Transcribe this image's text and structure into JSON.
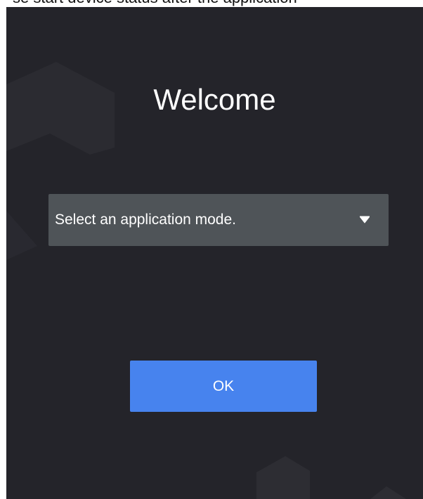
{
  "top_fragment": {
    "text": "se start device status after the application"
  },
  "welcome": {
    "title": "Welcome"
  },
  "mode_select": {
    "placeholder": "Select an application mode.",
    "icon": "chevron-down-icon"
  },
  "ok_button": {
    "label": "OK"
  },
  "colors": {
    "background": "#24242a",
    "select_background": "#4f5458",
    "primary": "#4783ee",
    "text": "#ffffff"
  }
}
